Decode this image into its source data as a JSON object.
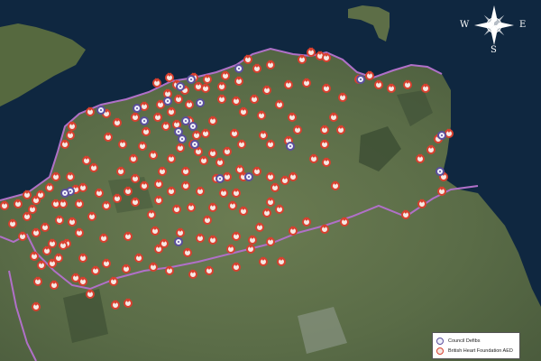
{
  "compass": {
    "north": "N",
    "east": "E",
    "south": "S",
    "west": "W"
  },
  "legend": {
    "council_label": "Council Defibs",
    "bhf_label": "British Heart Foundation AED"
  },
  "colors": {
    "sea": "#0f2740",
    "land": "#596b47",
    "boundary": "#b070c8",
    "bhf_marker": "#d8402f",
    "council_marker": "#5b4f9c"
  },
  "marker_icons": {
    "bhf": "heart-pin-icon",
    "council": "shield-pin-icon"
  },
  "markers": {
    "bhf_count": 214,
    "council_count": 22
  }
}
